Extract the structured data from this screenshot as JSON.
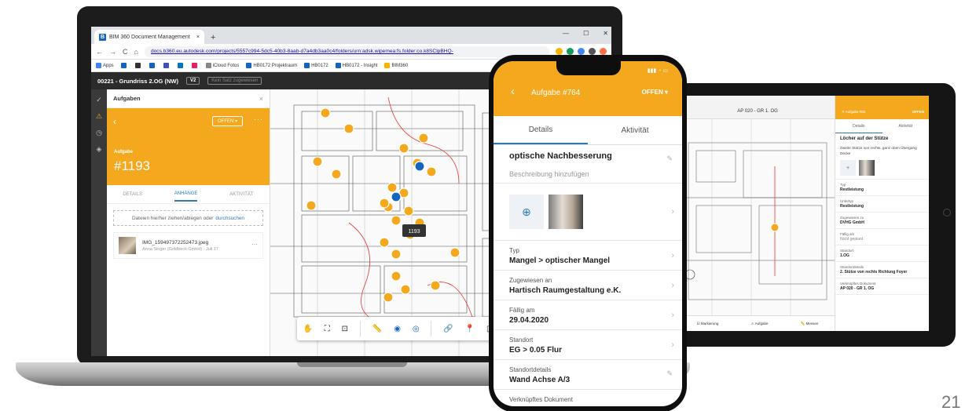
{
  "laptop": {
    "browser": {
      "tab_title": "BIM 360 Document Management",
      "tab_close": "×",
      "new_tab": "+",
      "url": "docs.b360.eu.autodesk.com/projects/5557c994-5dc5-40b3-8aab-d7a4db3aa0c4/folders/urn:adsk.wipemea:fs.folder:co.k8SClpBHQ-",
      "bookmarks": [
        "Apps",
        "iCloud Fotos",
        "HB0172 Projektraum",
        "HB0172",
        "HB0172 - Insight",
        "BIM360"
      ]
    },
    "app": {
      "doc_title": "00221 - Grundriss 2.OG (NW)",
      "version": "V2",
      "set_label": "Kein Satz zugewiesen"
    },
    "panel": {
      "header": "Aufgaben",
      "close": "×",
      "status_button": "OFFEN",
      "label": "Aufgabe",
      "number": "#1193",
      "tabs": [
        "DETAILS",
        "ANHÄNGE",
        "AKTIVITÄT"
      ],
      "drop_text": "Dateien hierher ziehen/ablegen oder",
      "drop_link": "durchsuchen",
      "attachment": {
        "name": "IMG_159497372252473.jpeg",
        "meta": "Anna Singer (Goldbeck GmbH) · Juli 17"
      }
    },
    "plan": {
      "marker_label": "1193"
    }
  },
  "phone": {
    "header": {
      "title": "Aufgabe #764",
      "status": "OFFEN"
    },
    "tabs": [
      "Details",
      "Aktivität"
    ],
    "summary": {
      "title": "optische Nachbesserung",
      "hint": "Beschreibung hinzufügen"
    },
    "fields": [
      {
        "label": "Typ",
        "value": "Mangel > optischer Mangel"
      },
      {
        "label": "Zugewiesen an",
        "value": "Hartisch Raumgestaltung e.K."
      },
      {
        "label": "Fällig am",
        "value": "29.04.2020"
      },
      {
        "label": "Standort",
        "value": "EG > 0.05 Flur"
      },
      {
        "label": "Standortdetails",
        "value": "Wand Achse A/3"
      }
    ],
    "linked_doc": "Verknüpftes Dokument"
  },
  "tablet": {
    "plan_title": "AP 020 - GR 1. OG",
    "header": {
      "title": "Aufgabe #82",
      "status": "OFFEN"
    },
    "tabs": [
      "Details",
      "Aktivität"
    ],
    "title": "Löcher auf der Stütze",
    "subtitle": "Zweite Stütze von rechts, ganz oben Übergang Decke",
    "fields": [
      {
        "label": "Typ",
        "value": "Restleistung"
      },
      {
        "label": "Untertyp",
        "value": "Restleistung"
      },
      {
        "label": "Zugewiesen zu",
        "value": "DVHG GmbH"
      },
      {
        "label": "Fällig am",
        "value": "Nicht geplant"
      },
      {
        "label": "Standort",
        "value": "1.OG"
      },
      {
        "label": "Standortdetails",
        "value": "2. Stütze von rechts Richtung Foyer"
      },
      {
        "label": "Verknüpftes Dokument",
        "value": "AP 020 - GR 1. OG"
      }
    ],
    "bottom_bar": [
      "Markierung",
      "Aufgabe",
      "Messen"
    ]
  },
  "page_number": "21",
  "colors": {
    "accent": "#f4a81d",
    "link": "#2b7bb9",
    "marker_blue": "#1565c0"
  }
}
